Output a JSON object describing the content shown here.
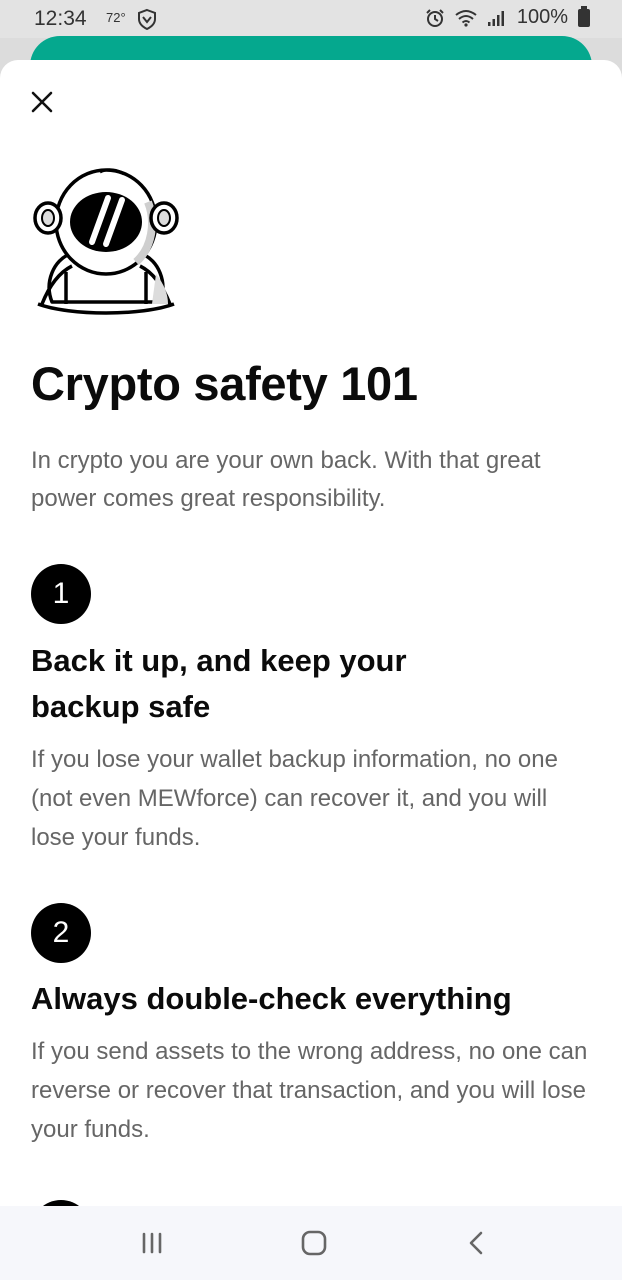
{
  "status_bar": {
    "time": "12:34",
    "temperature": "72°",
    "battery": "100%"
  },
  "sheet": {
    "title": "Crypto safety 101",
    "intro": "In crypto you are your own back. With that great power comes great responsibility.",
    "steps": [
      {
        "number": "1",
        "title_line1": "Back it up, and keep your",
        "title_line2": "backup safe",
        "body": "If you lose your wallet backup information, no one (not even MEWforce) can recover it, and you will lose your funds."
      },
      {
        "number": "2",
        "title_line1": "Always double-check everything",
        "body": "If you send assets to the wrong address, no one can reverse or recover that transaction, and you will lose your funds."
      }
    ]
  },
  "colors": {
    "accent_green": "#05a88e",
    "step_circle": "#000000",
    "body_text": "#666666"
  },
  "icons": {
    "close": "close-icon",
    "mascot": "astronaut-mascot-icon",
    "nav_recents": "recents-icon",
    "nav_home": "home-icon",
    "nav_back": "back-icon"
  }
}
